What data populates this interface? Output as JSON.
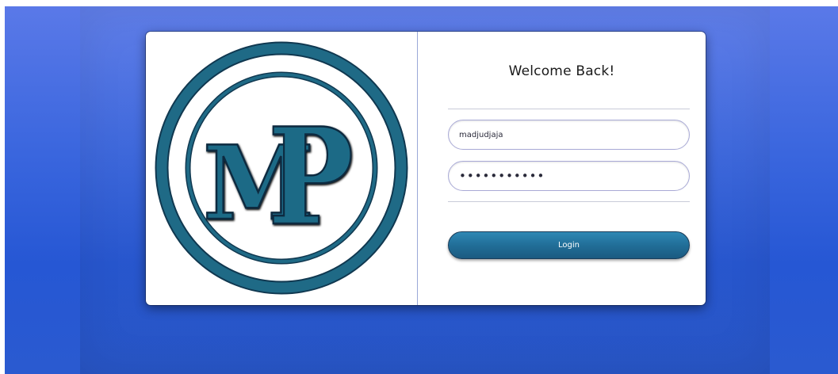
{
  "logo": {
    "letters": "MP",
    "color": "#1f6a86",
    "dark_color": "#103850"
  },
  "login_form": {
    "title": "Welcome Back!",
    "username": "madjudjaja",
    "password": "•••••••••••",
    "login_label": "Login"
  },
  "colors": {
    "background_top": "#5a79e8",
    "background_bottom": "#2657d4",
    "button": "#216e98",
    "field_border": "#a9aad6"
  }
}
